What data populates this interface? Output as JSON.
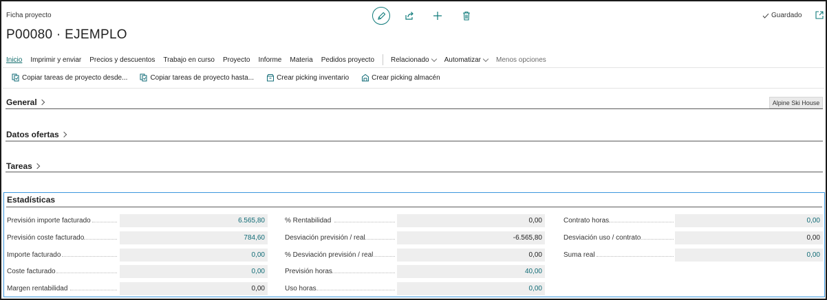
{
  "page": {
    "caption": "Ficha proyecto",
    "title": "P00080 · EJEMPLO",
    "saved_label": "Guardado"
  },
  "icons": {
    "edit": "pencil-icon",
    "share": "share-icon",
    "new": "plus-icon",
    "delete": "trash-icon",
    "saved": "checkmark-icon",
    "popout": "open-in-new-window-icon"
  },
  "menu": {
    "items": [
      {
        "label": "Inicio"
      },
      {
        "label": "Imprimir y enviar"
      },
      {
        "label": "Precios y descuentos"
      },
      {
        "label": "Trabajo en curso"
      },
      {
        "label": "Proyecto"
      },
      {
        "label": "Informe"
      },
      {
        "label": "Materia"
      },
      {
        "label": "Pedidos proyecto"
      }
    ],
    "related": "Relacionado",
    "automate": "Automatizar",
    "fewer": "Menos opciones"
  },
  "commands": [
    {
      "label": "Copiar tareas de proyecto desde...",
      "icon": "copy-tasks-from-icon"
    },
    {
      "label": "Copiar tareas de proyecto hasta...",
      "icon": "copy-tasks-to-icon"
    },
    {
      "label": "Crear picking inventario",
      "icon": "inventory-pick-icon"
    },
    {
      "label": "Crear picking almacén",
      "icon": "warehouse-pick-icon"
    }
  ],
  "sections": {
    "general": "General",
    "general_badge": "Alpine Ski House",
    "offers": "Datos ofertas",
    "tasks": "Tareas",
    "stats": "Estadísticas"
  },
  "stats": {
    "col1": [
      {
        "label": "Previsión importe facturado",
        "value": "6.565,80"
      },
      {
        "label": "Previsión coste facturado",
        "value": "784,60"
      },
      {
        "label": "Importe facturado",
        "value": "0,00"
      },
      {
        "label": "Coste facturado",
        "value": "0,00"
      },
      {
        "label": "Margen rentabilidad",
        "value": "0,00"
      }
    ],
    "col2": [
      {
        "label": "% Rentabilidad",
        "value": "0,00"
      },
      {
        "label": "Desviación previsión / real",
        "value": "-6.565,80"
      },
      {
        "label": "% Desviación previsión / real",
        "value": "0,00"
      },
      {
        "label": "Previsión horas",
        "value": "40,00"
      },
      {
        "label": "Uso horas",
        "value": "0,00"
      }
    ],
    "col3": [
      {
        "label": "Contrato horas",
        "value": "0,00"
      },
      {
        "label": "Desviación uso / contrato",
        "value": "0,00"
      },
      {
        "label": "Suma real",
        "value": "0,00"
      }
    ]
  },
  "colors": {
    "accent": "#0e6a75",
    "focus_border": "#3a96dd"
  }
}
